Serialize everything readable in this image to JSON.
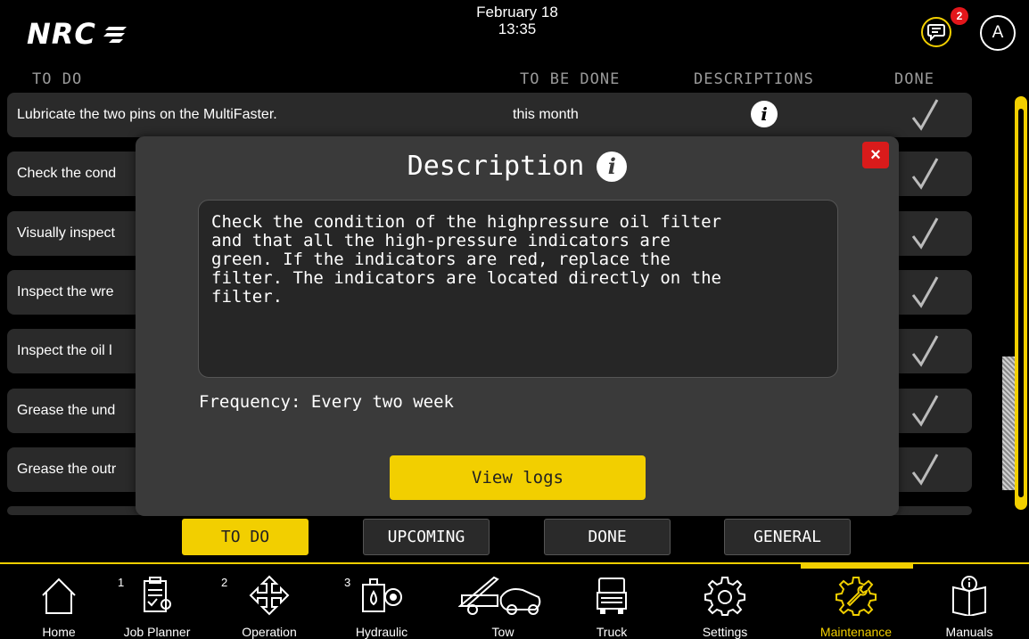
{
  "header": {
    "brand": "NRC",
    "date": "February 18",
    "time": "13:35",
    "chat_badge": "2",
    "avatar_initial": "A"
  },
  "columns": {
    "todo": "TO DO",
    "to_be_done": "TO BE DONE",
    "descriptions": "DESCRIPTIONS",
    "done": "DONE"
  },
  "tasks": [
    {
      "task": "Lubricate the two pins on the MultiFaster.",
      "due": "this month"
    },
    {
      "task": "Check the cond",
      "due": ""
    },
    {
      "task": "Visually inspect",
      "due": ""
    },
    {
      "task": "Inspect the wre",
      "due": ""
    },
    {
      "task": "Inspect the oil l",
      "due": ""
    },
    {
      "task": "Grease the und",
      "due": ""
    },
    {
      "task": "Grease the outr",
      "due": ""
    }
  ],
  "info_glyph": "i",
  "modal": {
    "title": "Description",
    "close": "×",
    "description": "Check the condition of the highpressure oil filter\nand that all the high-pressure indicators are\ngreen. If the indicators are red, replace the\nfilter. The indicators are located directly on the\nfilter.",
    "frequency": "Frequency: Every two week",
    "view_logs": "View logs"
  },
  "tabs": [
    {
      "label": "TO DO",
      "active": true
    },
    {
      "label": "UPCOMING",
      "active": false
    },
    {
      "label": "DONE",
      "active": false
    },
    {
      "label": "GENERAL",
      "active": false
    }
  ],
  "nav": [
    {
      "label": "Home",
      "num": "",
      "icon": "home-icon"
    },
    {
      "label": "Job Planner",
      "num": "1",
      "icon": "clipboard-icon"
    },
    {
      "label": "Operation",
      "num": "2",
      "icon": "move-arrows-icon"
    },
    {
      "label": "Hydraulic",
      "num": "3",
      "icon": "hydraulic-gauge-icon"
    },
    {
      "label": "Tow",
      "num": "",
      "icon": "tow-truck-icon"
    },
    {
      "label": "Truck",
      "num": "",
      "icon": "truck-icon"
    },
    {
      "label": "Settings",
      "num": "",
      "icon": "gear-icon"
    },
    {
      "label": "Maintenance",
      "num": "",
      "icon": "wrench-gear-icon",
      "active": true
    },
    {
      "label": "Manuals",
      "num": "",
      "icon": "manual-book-icon"
    }
  ],
  "colors": {
    "accent": "#f2cf00",
    "row_bg": "#2a2a2a",
    "modal_bg": "#3a3a3a",
    "close_red": "#d91b1b",
    "badge_red": "#e3161b"
  }
}
